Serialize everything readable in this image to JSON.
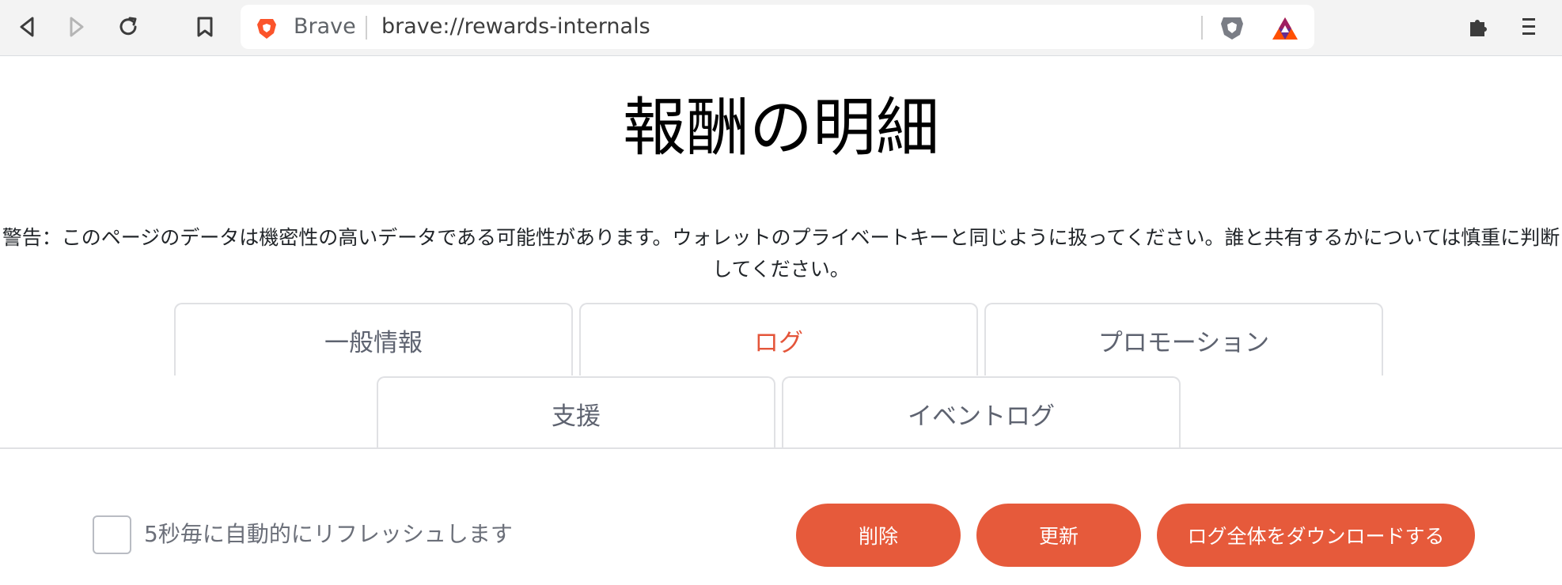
{
  "browser": {
    "site_name": "Brave",
    "url": "brave://rewards-internals",
    "icons": {
      "back": "back-arrow-icon",
      "forward": "forward-arrow-icon",
      "reload": "reload-icon",
      "bookmark": "bookmark-icon",
      "site": "brave-lion-icon",
      "shields": "brave-shields-icon",
      "rewards": "bat-rewards-icon",
      "extensions": "puzzle-piece-icon",
      "menu": "kebab-menu-icon"
    }
  },
  "page": {
    "title": "報酬の明細",
    "warning": "警告：このページのデータは機密性の高いデータである可能性があります。ウォレットのプライベートキーと同じように扱ってください。誰と共有するかについては慎重に判断してください。"
  },
  "tabs": [
    {
      "label": "一般情報",
      "active": false
    },
    {
      "label": "ログ",
      "active": true
    },
    {
      "label": "プロモーション",
      "active": false
    },
    {
      "label": "支援",
      "active": false
    },
    {
      "label": "イベントログ",
      "active": false
    }
  ],
  "controls": {
    "auto_refresh_label": "5秒毎に自動的にリフレッシュします",
    "auto_refresh_checked": false,
    "delete_label": "削除",
    "refresh_label": "更新",
    "download_label": "ログ全体をダウンロードする"
  },
  "colors": {
    "accent": "#e65a3b",
    "active_tab_text": "#e4553a",
    "toolbar_bg": "#f3f3f3"
  }
}
